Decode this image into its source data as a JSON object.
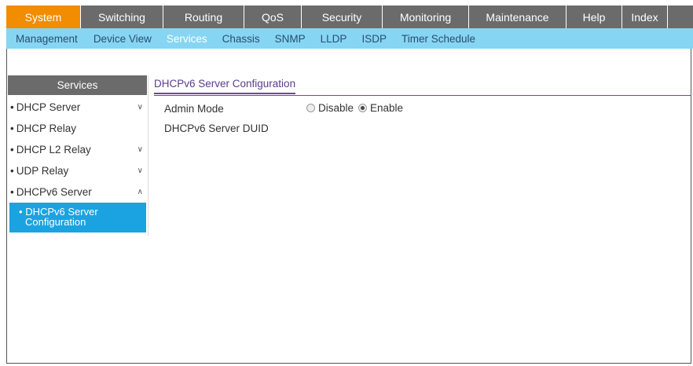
{
  "topnav": {
    "tabs": [
      "System",
      "Switching",
      "Routing",
      "QoS",
      "Security",
      "Monitoring",
      "Maintenance",
      "Help",
      "Index"
    ]
  },
  "subnav": {
    "items": [
      "Management",
      "Device View",
      "Services",
      "Chassis",
      "SNMP",
      "LLDP",
      "ISDP",
      "Timer Schedule"
    ]
  },
  "sidebar": {
    "header": "Services",
    "items": [
      {
        "label": "DHCP Server",
        "bullet": "•"
      },
      {
        "label": "DHCP Relay",
        "bullet": "•"
      },
      {
        "label": "DHCP L2 Relay",
        "bullet": "•"
      },
      {
        "label": "UDP Relay",
        "bullet": "•"
      },
      {
        "label": "DHCPv6 Server",
        "bullet": "•"
      }
    ],
    "selected": {
      "bullet": "•",
      "line1": "DHCPv6 Server",
      "line2": "Configuration"
    }
  },
  "content": {
    "tab": "DHCPv6 Server Configuration",
    "admin_mode_label": "Admin Mode",
    "disable_label": "Disable",
    "enable_label": "Enable",
    "duid_label": "DHCPv6 Server DUID"
  },
  "colors": {
    "nav_bg": "#6b6b6b",
    "nav_active": "#f28c00",
    "subnav_bg": "#86d5f3",
    "sidebar_selected": "#1aa3e0",
    "content_accent": "#6a4a9c"
  }
}
